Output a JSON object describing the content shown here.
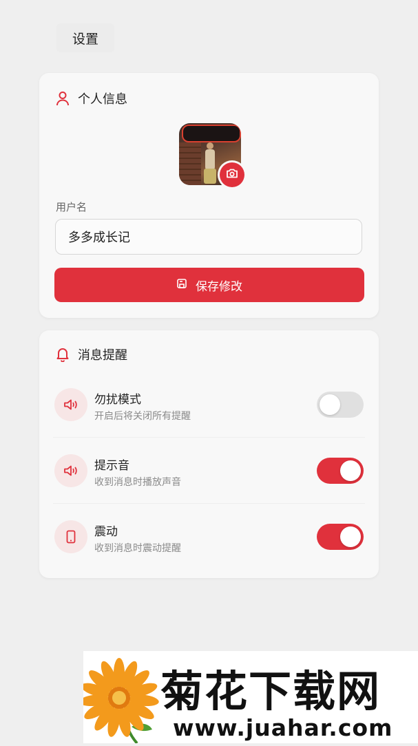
{
  "header": {
    "title": "设置"
  },
  "profile": {
    "section_title": "个人信息",
    "field_label": "用户名",
    "username_value": "多多成长记",
    "save_label": "保存修改"
  },
  "notifications": {
    "section_title": "消息提醒",
    "items": [
      {
        "title": "勿扰模式",
        "desc": "开启后将关闭所有提醒",
        "enabled": false,
        "icon": "speaker-icon"
      },
      {
        "title": "提示音",
        "desc": "收到消息时播放声音",
        "enabled": true,
        "icon": "speaker-icon"
      },
      {
        "title": "震动",
        "desc": "收到消息时震动提醒",
        "enabled": true,
        "icon": "phone-icon"
      }
    ]
  },
  "colors": {
    "accent": "#e0313c",
    "background": "#efefef",
    "card": "#f8f8f8"
  },
  "watermark": {
    "title": "菊花下载网",
    "url": "www.juahar.com"
  }
}
